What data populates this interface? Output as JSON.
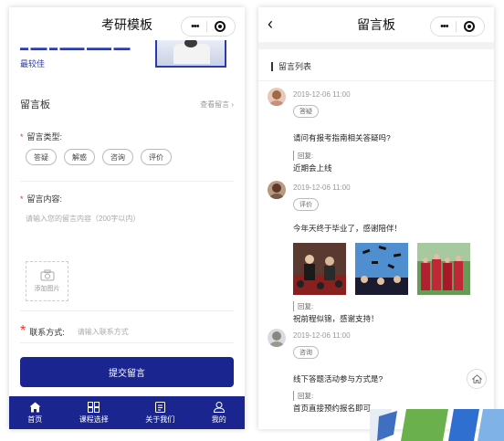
{
  "left": {
    "nav_title": "考研模板",
    "top_more": "最较佳",
    "section_title": "留言板",
    "section_link": "查看留言",
    "type_label": "留言类型:",
    "type_options": [
      "答疑",
      "解惑",
      "咨询",
      "评价"
    ],
    "content_label": "留言内容:",
    "content_placeholder": "请输入您的留言内容（200字以内）",
    "upload_label": "添加图片",
    "contact_label": "联系方式:",
    "contact_placeholder": "请输入联系方式",
    "submit_label": "提交留言",
    "tabs": [
      {
        "label": "首页",
        "icon": "home-icon"
      },
      {
        "label": "课程选择",
        "icon": "grid-icon"
      },
      {
        "label": "关于我们",
        "icon": "document-icon"
      },
      {
        "label": "我的",
        "icon": "person-icon"
      }
    ],
    "colors": {
      "primary": "#1a2590",
      "accent": "#2a3bb0",
      "required": "#e33333"
    }
  },
  "right": {
    "nav_title": "留言板",
    "list_title": "留言列表",
    "messages": [
      {
        "time": "2019-12-06 11:00",
        "tag": "答疑",
        "content": "请问有报考指南相关答疑吗?",
        "reply_label": "回复:",
        "reply": "近期会上线"
      },
      {
        "time": "2019-12-06 11:00",
        "tag": "评价",
        "content": "今年天终于毕业了，感谢陪伴！",
        "reply_label": "回复:",
        "reply": "祝前程似锦，感谢支持！"
      },
      {
        "time": "2019-12-06 11:00",
        "tag": "咨询",
        "content": "线下答题活动参与方式是?",
        "reply_label": "回复:",
        "reply": "首页直接预约报名即可"
      }
    ]
  }
}
